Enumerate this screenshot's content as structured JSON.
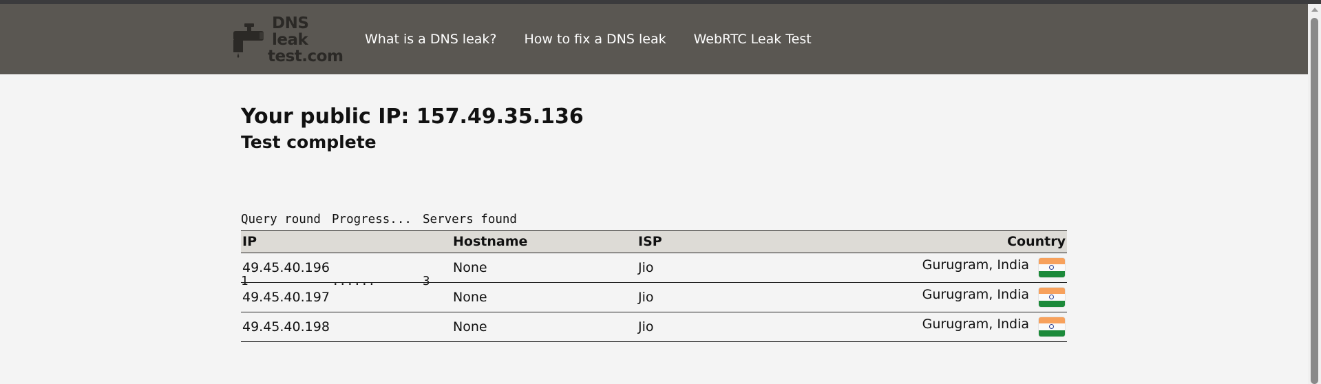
{
  "header": {
    "logo": {
      "line1": "DNS leak",
      "line2": "test.com"
    },
    "nav": [
      {
        "label": "What is a DNS leak?"
      },
      {
        "label": "How to fix a DNS leak"
      },
      {
        "label": "WebRTC Leak Test"
      }
    ]
  },
  "main": {
    "title": "Your public IP: 157.49.35.136",
    "status": "Test complete",
    "query_table": {
      "headers": [
        "Query round",
        "Progress...",
        "Servers found"
      ],
      "row": [
        "1",
        "......",
        "3"
      ]
    }
  },
  "results": {
    "headers": {
      "ip": "IP",
      "hostname": "Hostname",
      "isp": "ISP",
      "country": "Country"
    },
    "rows": [
      {
        "ip": "49.45.40.196",
        "hostname": "None",
        "isp": "Jio",
        "country": "Gurugram, India",
        "flag": "india-flag-icon"
      },
      {
        "ip": "49.45.40.197",
        "hostname": "None",
        "isp": "Jio",
        "country": "Gurugram, India",
        "flag": "india-flag-icon"
      },
      {
        "ip": "49.45.40.198",
        "hostname": "None",
        "isp": "Jio",
        "country": "Gurugram, India",
        "flag": "india-flag-icon"
      }
    ]
  },
  "colors": {
    "navbar": "#5a5752",
    "page_background": "#f4f4f4",
    "table_header": "#dddbd6"
  }
}
